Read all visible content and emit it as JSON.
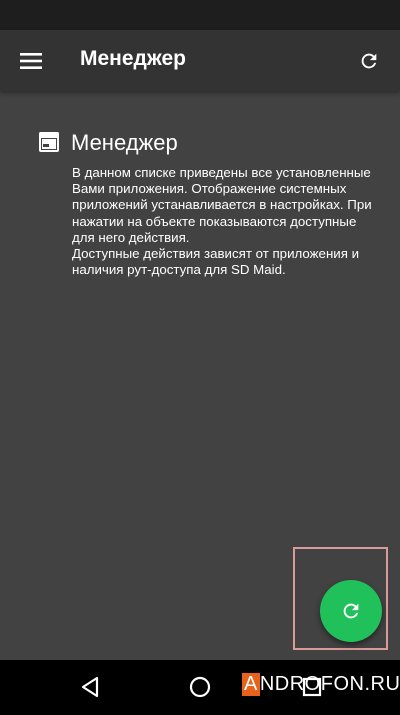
{
  "app_bar": {
    "title": "Менеджер"
  },
  "info_card": {
    "title": "Менеджер",
    "paragraph_1": "В данном списке приведены все установленные Вами приложения. Отображение системных приложений устанавливается в настройках. При нажатии на объекте показываются доступные для него действия.",
    "paragraph_2": "Доступные действия зависят от приложения и наличия рут-доступа для SD Maid."
  },
  "watermark": {
    "first_letter": "A",
    "rest": "NDROFON.RU"
  },
  "icons": {
    "menu": "hamburger-menu-icon",
    "refresh": "refresh-icon",
    "card": "app-window-icon",
    "fab": "refresh-icon",
    "nav_back": "triangle-back-icon",
    "nav_home": "circle-home-icon",
    "nav_recent": "square-recent-icon"
  },
  "colors": {
    "background": "#424242",
    "app_bar": "#333333",
    "fab": "#20c15a",
    "highlight": "#d99a98",
    "watermark_accent": "#e8621a"
  }
}
